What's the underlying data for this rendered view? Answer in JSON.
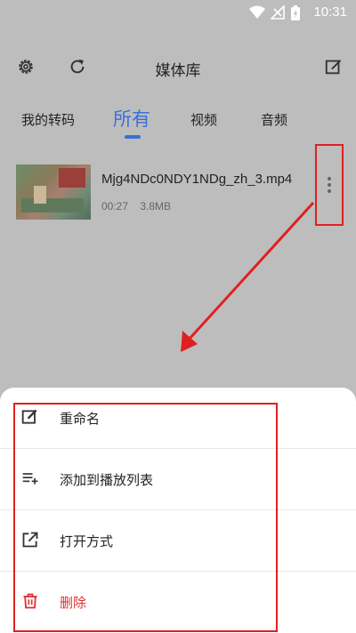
{
  "status_bar": {
    "time": "10:31"
  },
  "app_bar": {
    "title": "媒体库",
    "left_icons": [
      "gear-icon",
      "refresh-icon"
    ],
    "right_icon": "edit-icon"
  },
  "tabs": [
    {
      "label": "我的转码",
      "active": false
    },
    {
      "label": "所有",
      "active": true
    },
    {
      "label": "视频",
      "active": false
    },
    {
      "label": "音频",
      "active": false
    }
  ],
  "media_items": [
    {
      "name": "Mjg4NDc0NDY1NDg_zh_3.mp4",
      "duration": "00:27",
      "size": "3.8MB"
    }
  ],
  "action_sheet": {
    "items": [
      {
        "label": "重命名",
        "icon": "edit-icon",
        "danger": false
      },
      {
        "label": "添加到播放列表",
        "icon": "playlist-add-icon",
        "danger": false
      },
      {
        "label": "打开方式",
        "icon": "open-external-icon",
        "danger": false
      },
      {
        "label": "删除",
        "icon": "trash-icon",
        "danger": true
      }
    ]
  },
  "colors": {
    "accent": "#3a6fd8",
    "annotation": "#e02020",
    "danger": "#e03030"
  }
}
